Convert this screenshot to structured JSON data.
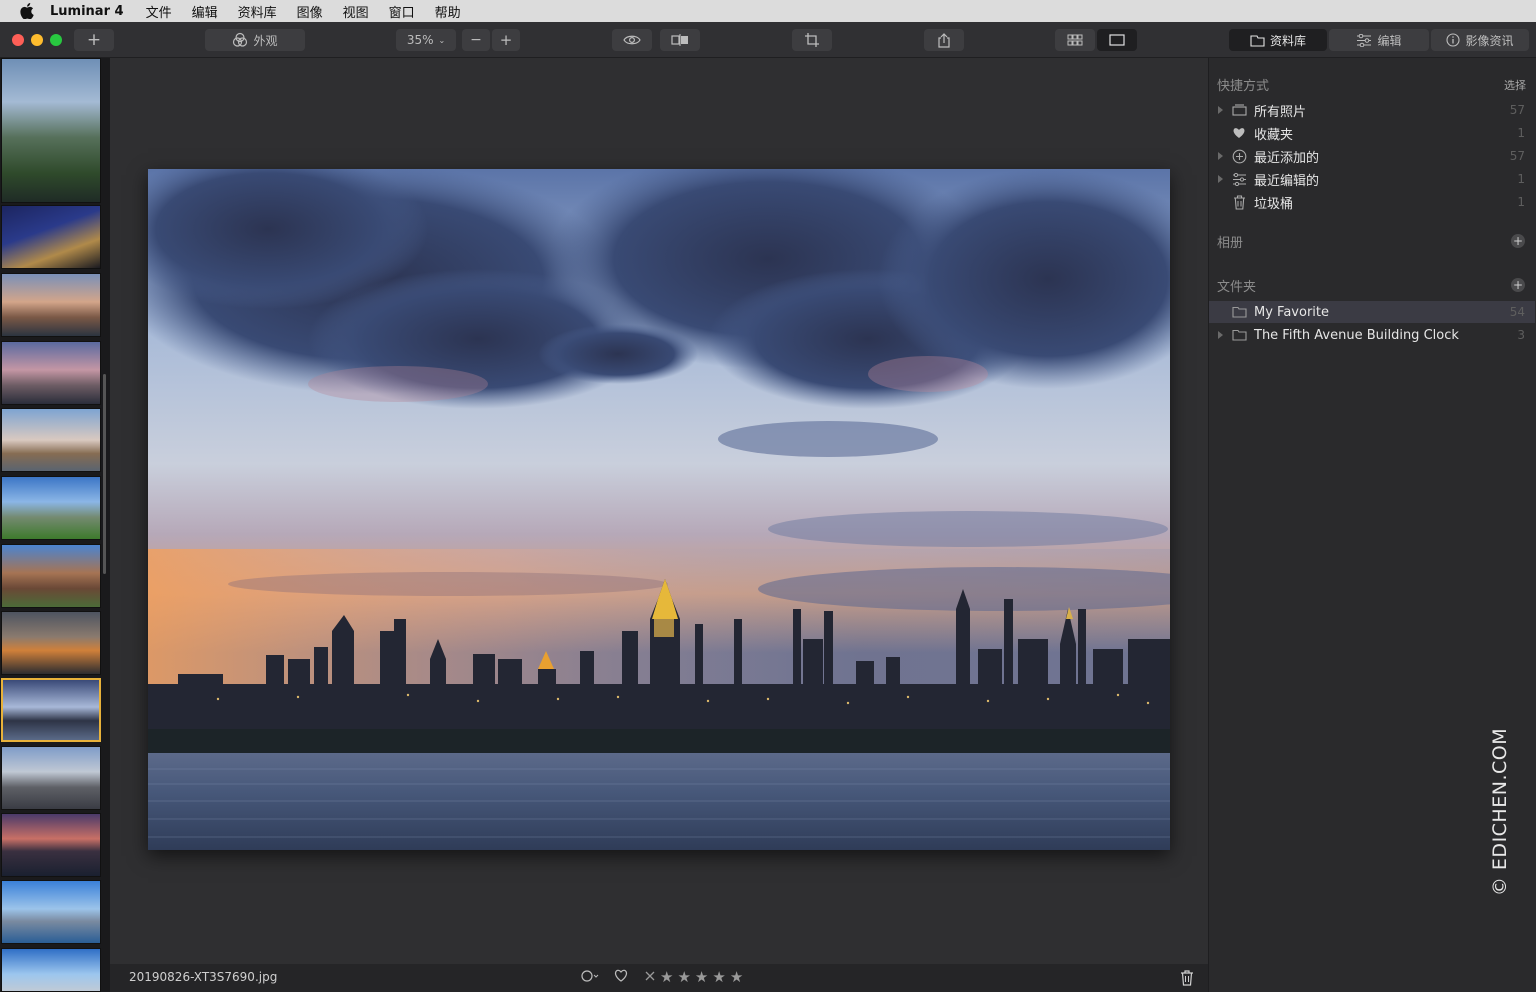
{
  "menubar": {
    "app_name": "Luminar 4",
    "items": [
      "文件",
      "编辑",
      "资料库",
      "图像",
      "视图",
      "窗口",
      "帮助"
    ]
  },
  "toolbar": {
    "add_label": "+",
    "looks_label": "外观",
    "zoom_value": "35%",
    "zoom_out_label": "−",
    "zoom_in_label": "+",
    "tabs": {
      "library": "资料库",
      "edit": "编辑",
      "info": "影像资讯"
    }
  },
  "filmstrip": {
    "thumb_count": 14,
    "selected_index": 9
  },
  "viewer": {
    "filename": "20190826-XT3S7690.jpg"
  },
  "rating": {
    "stars": 5,
    "value": 0
  },
  "panel": {
    "shortcuts": {
      "title": "快捷方式",
      "action": "选择",
      "items": [
        {
          "label": "所有照片",
          "count": "57",
          "icon": "photos-icon"
        },
        {
          "label": "收藏夹",
          "count": "1",
          "icon": "heart-icon"
        },
        {
          "label": "最近添加的",
          "count": "57",
          "icon": "plus-circle-icon"
        },
        {
          "label": "最近编辑的",
          "count": "1",
          "icon": "sliders-icon"
        },
        {
          "label": "垃圾桶",
          "count": "1",
          "icon": "trash-icon"
        }
      ]
    },
    "albums": {
      "title": "相册",
      "add": "+"
    },
    "folders": {
      "title": "文件夹",
      "add": "+",
      "items": [
        {
          "label": "My Favorite",
          "count": "54"
        },
        {
          "label": "The Fifth Avenue Building Clock",
          "count": "3"
        }
      ]
    }
  },
  "watermark": "© EDICHEN.COM",
  "colors": {
    "accent": "#e8b23a",
    "panel_bg": "#2a2a2c",
    "selected_row": "#3b3b44"
  }
}
